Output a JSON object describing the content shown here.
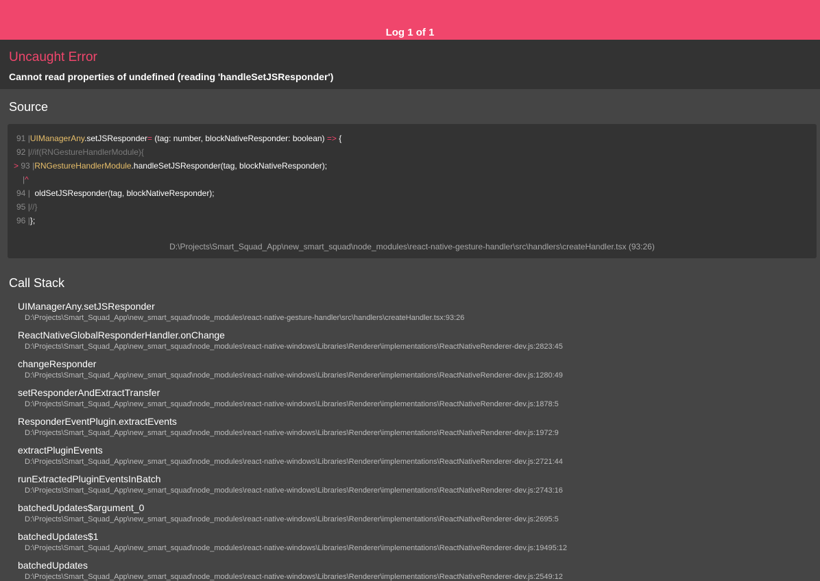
{
  "topbar": {
    "log_label": "Log 1 of 1"
  },
  "header": {
    "title": "Uncaught Error",
    "message": "Cannot read properties of undefined (reading 'handleSetJSResponder')"
  },
  "source": {
    "title": "Source",
    "lines": [
      {
        "num": "91",
        "prefix": "|",
        "obj": "UIManagerAny",
        "text": ".setJSResponder",
        "op": "=",
        "rest": " (tag: number, blockNativeResponder: boolean) ",
        "op2": "=>",
        "tail": " {"
      },
      {
        "num": "92",
        "prefix": "|",
        "dim": "//if(RNGestureHandlerModule){"
      },
      {
        "marker": ">",
        "num": "93",
        "prefix": "|",
        "obj": "RNGestureHandlerModule",
        "text": ".handleSetJSResponder(tag, blockNativeResponder);"
      },
      {
        "caret_pipe": "|",
        "caret": "^"
      },
      {
        "num": "94",
        "prefix": "|",
        "text": "  oldSetJSResponder(tag, blockNativeResponder);"
      },
      {
        "num": "95",
        "prefix": "|",
        "dim": "//}"
      },
      {
        "num": "96",
        "prefix": "|",
        "text": "};"
      }
    ],
    "path": "D:\\Projects\\Smart_Squad_App\\new_smart_squad\\node_modules\\react-native-gesture-handler\\src\\handlers\\createHandler.tsx (93:26)"
  },
  "callstack": {
    "title": "Call Stack",
    "frames": [
      {
        "fn": "UIManagerAny.setJSResponder",
        "loc": "D:\\Projects\\Smart_Squad_App\\new_smart_squad\\node_modules\\react-native-gesture-handler\\src\\handlers\\createHandler.tsx:93:26"
      },
      {
        "fn": "ReactNativeGlobalResponderHandler.onChange",
        "loc": "D:\\Projects\\Smart_Squad_App\\new_smart_squad\\node_modules\\react-native-windows\\Libraries\\Renderer\\implementations\\ReactNativeRenderer-dev.js:2823:45"
      },
      {
        "fn": "changeResponder",
        "loc": "D:\\Projects\\Smart_Squad_App\\new_smart_squad\\node_modules\\react-native-windows\\Libraries\\Renderer\\implementations\\ReactNativeRenderer-dev.js:1280:49"
      },
      {
        "fn": "setResponderAndExtractTransfer",
        "loc": "D:\\Projects\\Smart_Squad_App\\new_smart_squad\\node_modules\\react-native-windows\\Libraries\\Renderer\\implementations\\ReactNativeRenderer-dev.js:1878:5"
      },
      {
        "fn": "ResponderEventPlugin.extractEvents",
        "loc": "D:\\Projects\\Smart_Squad_App\\new_smart_squad\\node_modules\\react-native-windows\\Libraries\\Renderer\\implementations\\ReactNativeRenderer-dev.js:1972:9"
      },
      {
        "fn": "extractPluginEvents",
        "loc": "D:\\Projects\\Smart_Squad_App\\new_smart_squad\\node_modules\\react-native-windows\\Libraries\\Renderer\\implementations\\ReactNativeRenderer-dev.js:2721:44"
      },
      {
        "fn": "runExtractedPluginEventsInBatch",
        "loc": "D:\\Projects\\Smart_Squad_App\\new_smart_squad\\node_modules\\react-native-windows\\Libraries\\Renderer\\implementations\\ReactNativeRenderer-dev.js:2743:16"
      },
      {
        "fn": "batchedUpdates$argument_0",
        "loc": "D:\\Projects\\Smart_Squad_App\\new_smart_squad\\node_modules\\react-native-windows\\Libraries\\Renderer\\implementations\\ReactNativeRenderer-dev.js:2695:5"
      },
      {
        "fn": "batchedUpdates$1",
        "loc": "D:\\Projects\\Smart_Squad_App\\new_smart_squad\\node_modules\\react-native-windows\\Libraries\\Renderer\\implementations\\ReactNativeRenderer-dev.js:19495:12"
      },
      {
        "fn": "batchedUpdates",
        "loc": "D:\\Projects\\Smart_Squad_App\\new_smart_squad\\node_modules\\react-native-windows\\Libraries\\Renderer\\implementations\\ReactNativeRenderer-dev.js:2549:12"
      }
    ]
  },
  "colors": {
    "accent": "#f0466c",
    "header_bg": "#333333",
    "body_bg": "#454545",
    "code_object": "#e8bf6a"
  }
}
